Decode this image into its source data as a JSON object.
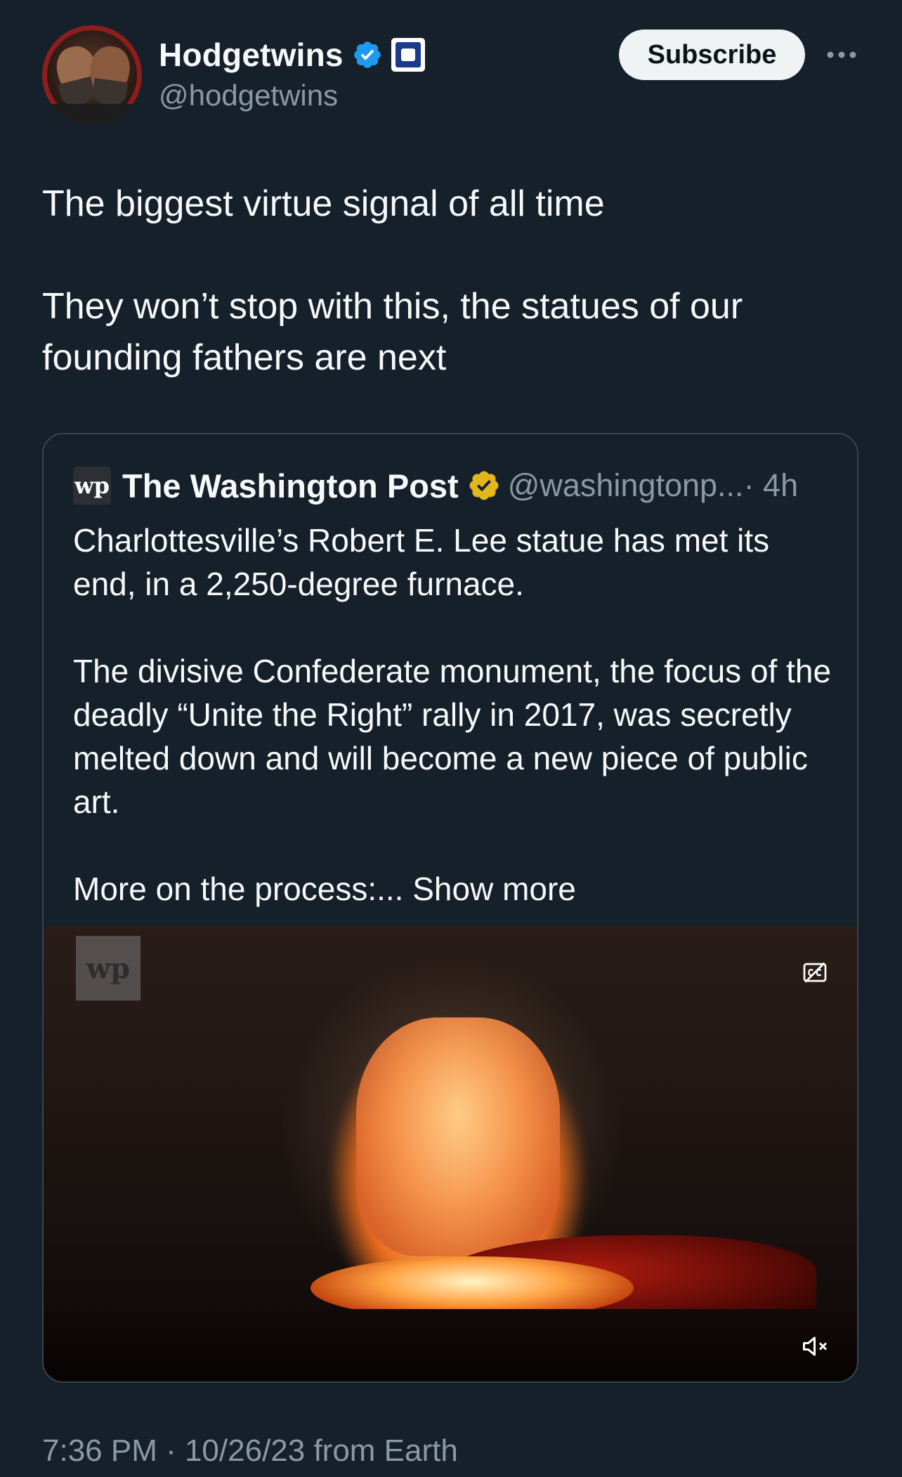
{
  "colors": {
    "background": "#15202b",
    "text_primary": "#f7f9f9",
    "text_secondary": "#8b98a5",
    "verified_blue": "#1d9bf0",
    "verified_gold": "#e2b719",
    "subscribe_bg": "#eff3f4",
    "card_border": "#38444d"
  },
  "author": {
    "name": "Hodgetwins",
    "handle": "@hodgetwins",
    "avatar_icon": "avatar-photo",
    "verified_icon": "verified-badge-icon",
    "affiliate_icon": "affiliate-badge-icon"
  },
  "actions": {
    "subscribe_label": "Subscribe",
    "more_icon": "more-options-icon"
  },
  "tweet": {
    "line1": "The biggest virtue signal of all time",
    "line2": "They won’t stop with this, the statues of our founding fathers are next"
  },
  "quoted_tweet": {
    "logo_text": "wp",
    "name": "The Washington Post",
    "handle": "@washingtonp...",
    "time": " · 4h",
    "paragraph1": "Charlottesville’s  Robert E. Lee statue has met its end, in a 2,250-degree furnace.",
    "paragraph2": "The divisive Confederate monument, the focus of the deadly “Unite the Right” rally in 2017, was secretly melted down and will become a new piece of public art.",
    "paragraph3_prefix": "More on the process:... ",
    "show_more": "Show more",
    "video": {
      "watermark": "wp",
      "cc_icon": "closed-captions-icon",
      "mute_icon": "muted-speaker-icon"
    }
  },
  "timestamp": "7:36 PM · 10/26/23 from Earth"
}
